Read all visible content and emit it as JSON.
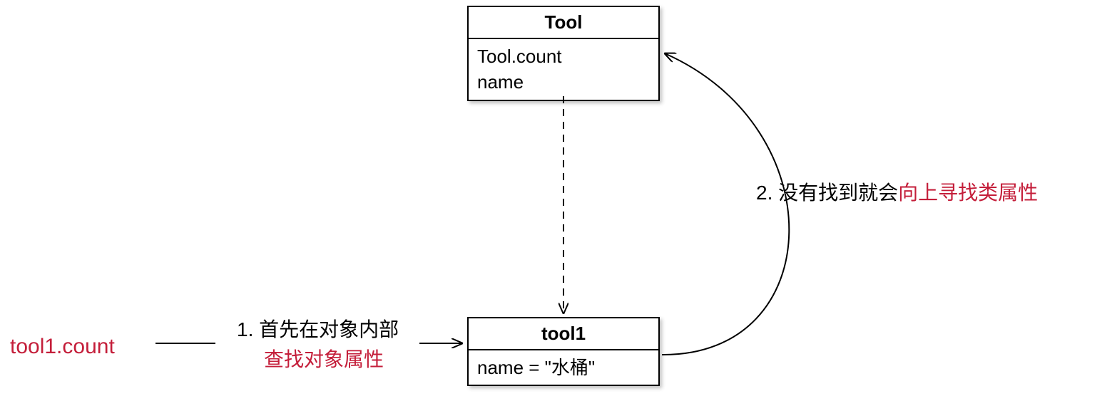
{
  "classBox": {
    "title": "Tool",
    "attr1": "Tool.count",
    "attr2": "name"
  },
  "instanceBox": {
    "title": "tool1",
    "attr1": "name = \"水桶\""
  },
  "entryLabel": "tool1.count",
  "step1": {
    "prefix": "1. 首先在对象内部",
    "red": "查找对象属性"
  },
  "step2": {
    "prefix": "2. 没有找到就会",
    "red": "向上寻找类属性"
  }
}
